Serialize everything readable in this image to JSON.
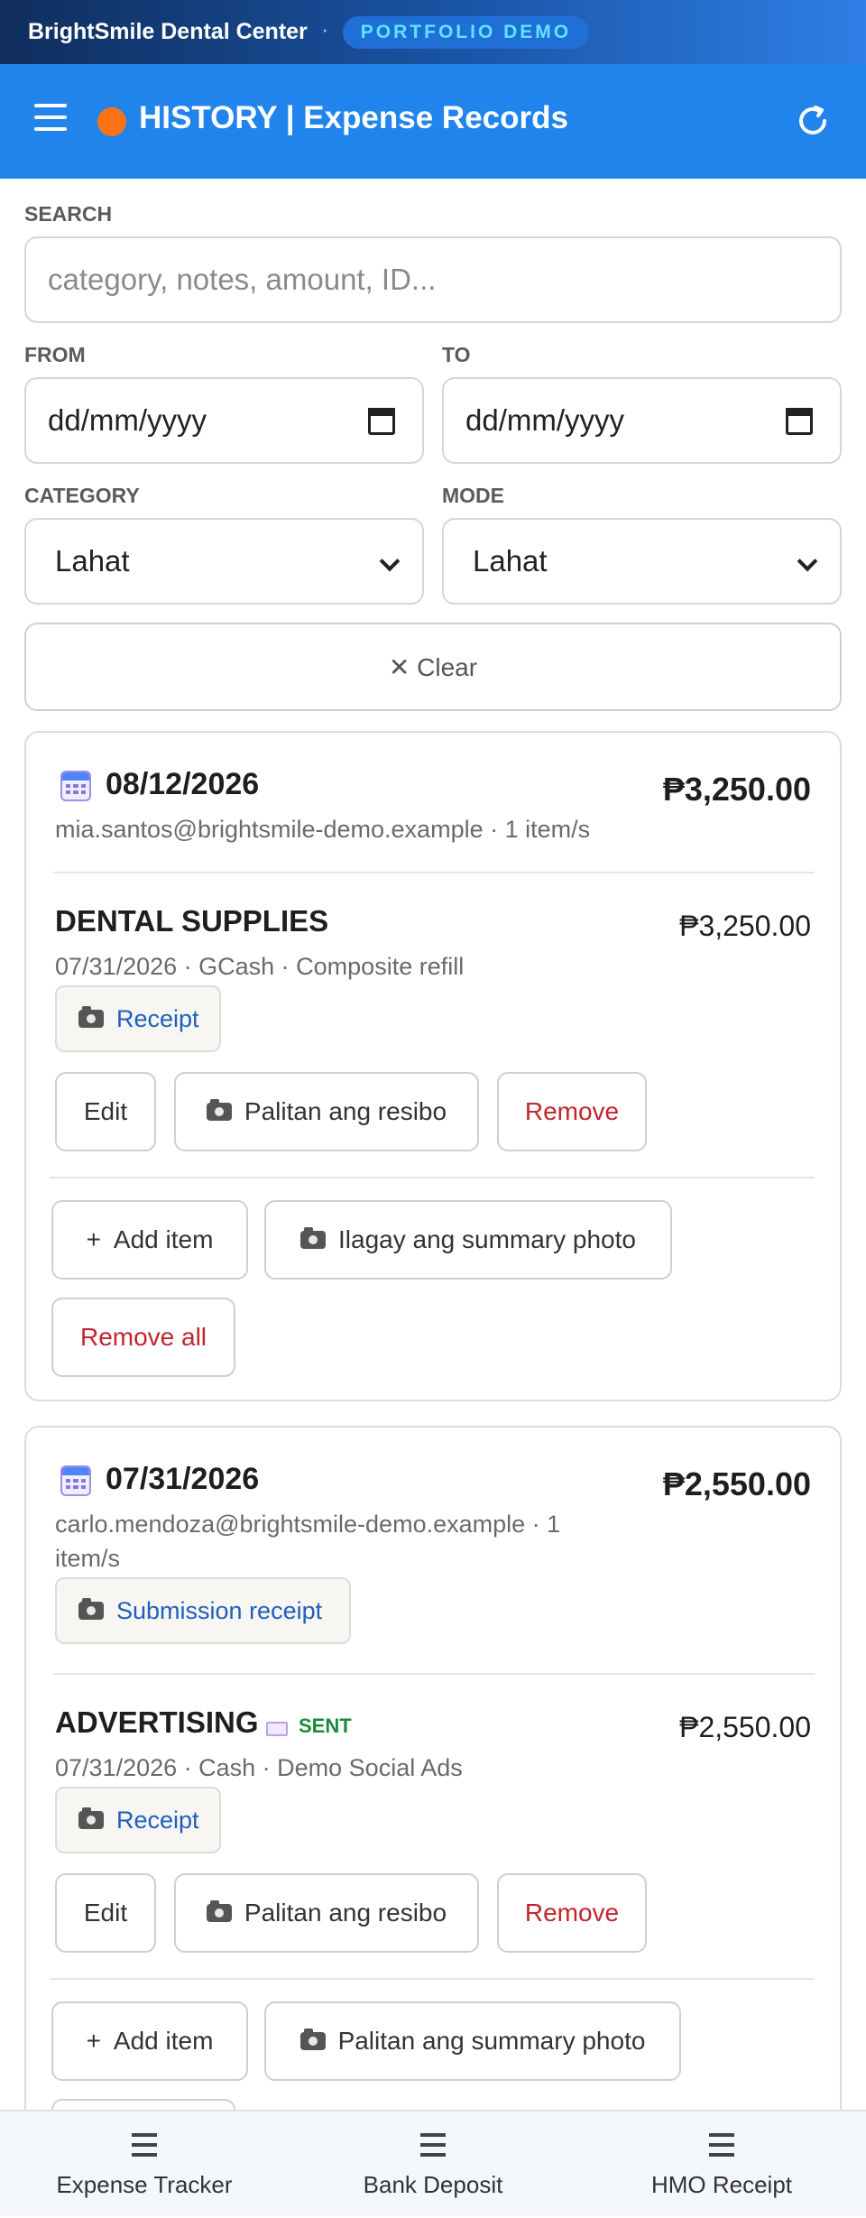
{
  "topbar": {
    "brand": "BrightSmile Dental Center",
    "separator": "·",
    "badge": "PORTFOLIO DEMO"
  },
  "header": {
    "title": "HISTORY | Expense Records",
    "menu_icon": "hamburger-icon",
    "status_color": "#f97316",
    "refresh_icon": "refresh-icon"
  },
  "filters": {
    "search_label": "SEARCH",
    "search_placeholder": "category, notes, amount, ID...",
    "from_label": "FROM",
    "from_value": "dd/mm/yyyy",
    "to_label": "TO",
    "to_value": "dd/mm/yyyy",
    "category_label": "CATEGORY",
    "category_value": "Lahat",
    "mode_label": "MODE",
    "mode_value": "Lahat",
    "clear_label": "✕ Clear"
  },
  "records": [
    {
      "date": "08/12/2026",
      "total": "₱3,250.00",
      "meta": "mia.santos@brightsmile-demo.example · 1 item/s",
      "items": [
        {
          "category": "DENTAL SUPPLIES",
          "amount": "₱3,250.00",
          "details": "07/31/2026 · GCash · Composite refill",
          "receipt_label": "Receipt"
        }
      ],
      "edit_label": "Edit",
      "replace_label": "Palitan ang resibo",
      "remove_label": "Remove",
      "add_item_label": "Add item",
      "summary_label": "Ilagay ang summary photo",
      "remove_all_label": "Remove all"
    },
    {
      "date": "07/31/2026",
      "total": "₱2,550.00",
      "meta_line1": "carlo.mendoza@brightsmile-demo.example · 1",
      "meta_line2": "item/s",
      "submission_receipt_label": "Submission receipt",
      "items": [
        {
          "category": "ADVERTISING",
          "status": "SENT",
          "amount": "₱2,550.00",
          "details": "07/31/2026 · Cash · Demo Social Ads",
          "receipt_label": "Receipt"
        }
      ],
      "edit_label": "Edit",
      "replace_label": "Palitan ang resibo",
      "remove_label": "Remove",
      "add_item_label": "Add item",
      "summary_label": "Palitan ang summary photo"
    }
  ],
  "bottom_nav": [
    {
      "label": "Expense Tracker",
      "icon": "list-icon"
    },
    {
      "label": "Bank Deposit",
      "icon": "list-icon"
    },
    {
      "label": "HMO Receipt",
      "icon": "list-icon"
    }
  ]
}
